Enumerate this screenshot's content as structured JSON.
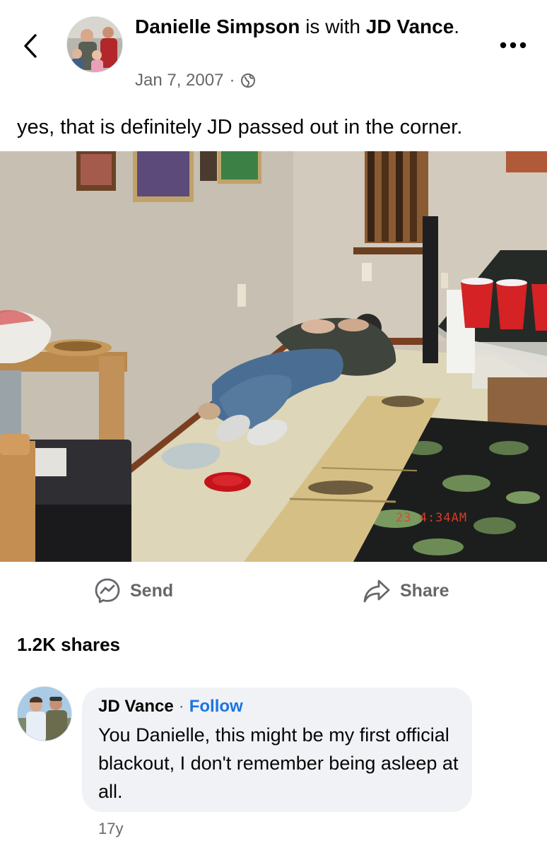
{
  "post": {
    "author": "Danielle Simpson",
    "with_text": "is with",
    "tagged": "JD Vance",
    "tagged_suffix": ".",
    "date": "Jan 7, 2007",
    "separator": "·",
    "privacy_icon": "globe-icon",
    "caption": "yes, that is definitely JD passed out in the corner."
  },
  "photo": {
    "timestamp_overlay": "23 4:34AM"
  },
  "actions": {
    "send_label": "Send",
    "send_icon": "messenger-icon",
    "share_label": "Share",
    "share_icon": "share-arrow-icon"
  },
  "shares_count": "1.2K shares",
  "comment": {
    "author": "JD Vance",
    "separator": "·",
    "follow_label": "Follow",
    "text": "You Danielle, this might be my first official blackout, I don't remember being asleep at all.",
    "time": "17y"
  },
  "colors": {
    "link_blue": "#1b74e4",
    "secondary_text": "#65676b",
    "comment_bubble": "#f0f2f5"
  }
}
